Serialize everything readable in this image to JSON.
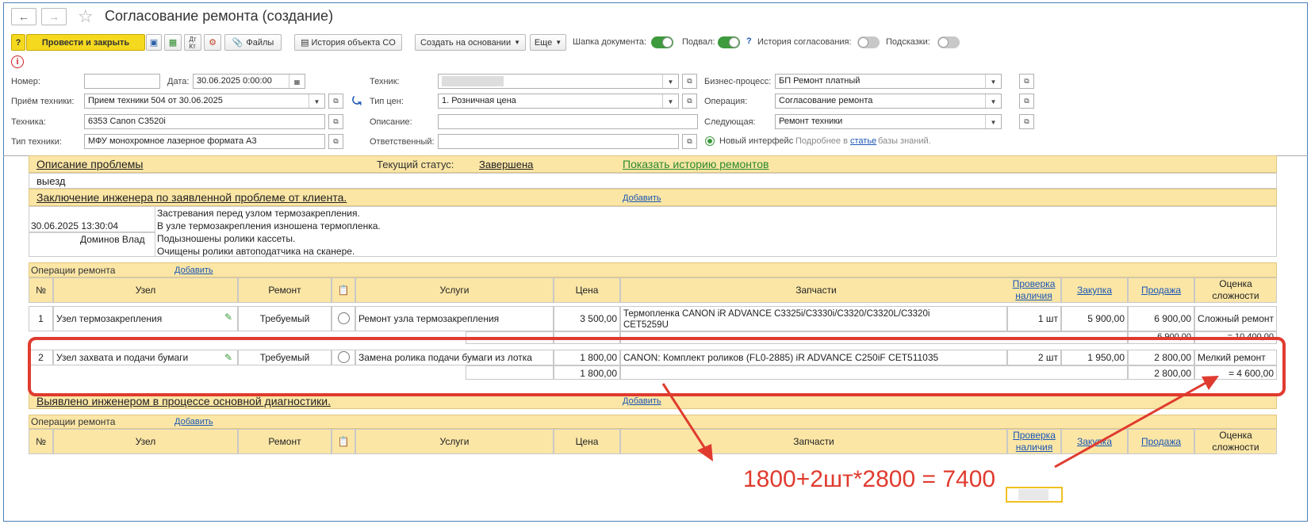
{
  "window": {
    "title": "Согласование ремонта (создание)"
  },
  "toolbar": {
    "post_close": "Провести и закрыть",
    "files": "Файлы",
    "history_co": "История объекта CO",
    "create_based": "Создать на основании",
    "more": "Еще",
    "doc_header": "Шапка документа:",
    "footer": "Подвал:",
    "help_q": "?",
    "approval_history": "История согласования:",
    "hints": "Подсказки:"
  },
  "form": {
    "number_label": "Номер:",
    "number_value": "",
    "date_label": "Дата:",
    "date_value": "30.06.2025  0:00:00",
    "technician_label": "Техник:",
    "technician_value": "",
    "business_process_label": "Бизнес-процесс:",
    "business_process_value": "БП Ремонт платный",
    "intake_label": "Приём техники:",
    "intake_value": "Прием техники 504 от 30.06.2025",
    "price_type_label": "Тип цен:",
    "price_type_value": "1. Розничная цена",
    "operation_label": "Операция:",
    "operation_value": "Согласование ремонта",
    "equipment_label": "Техника:",
    "equipment_value": "6353 Canon  C3520i",
    "description_label": "Описание:",
    "description_value": "",
    "next_label": "Следующая:",
    "next_value": "Ремонт техники",
    "equipment_type_label": "Тип техники:",
    "equipment_type_value": "МФУ монохромное лазерное формата А3",
    "responsible_label": "Ответственный:",
    "responsible_value": "",
    "new_interface": "Новый интерфейс",
    "more_in": "Подробнее в",
    "article": "статье",
    "kb": "базы знаний."
  },
  "problem": {
    "title": "Описание проблемы",
    "status_label": "Текущий статус:",
    "status_value": "Завершена",
    "history_link": "Показать историю ремонтов",
    "text": "выезд"
  },
  "conclusion": {
    "title": "Заключение инженера по заявленной проблеме от клиента.",
    "add": "Добавить",
    "datetime": "30.06.2025 13:30:04",
    "author": "Доминов Влад",
    "lines": [
      "Застревания перед узлом термозакрепления.",
      "В узле термозакрепления изношена термопленка.",
      "Подызношены ролики кассеты.",
      "Очищены ролики автоподатчика на сканере."
    ]
  },
  "ops_table": {
    "title": "Операции ремонта",
    "add": "Добавить",
    "headers": {
      "num": "№",
      "node": "Узел",
      "repair": "Ремонт",
      "services": "Услуги",
      "price": "Цена",
      "parts": "Запчасти",
      "check1": "Проверка",
      "check2": "наличия",
      "purchase": "Закупка",
      "sale": "Продажа",
      "complexity1": "Оценка",
      "complexity2": "сложности"
    },
    "rows": [
      {
        "num": "1",
        "node": "Узел термозакрепления",
        "repair": "Требуемый",
        "service": "Ремонт узла термозакрепления",
        "price": "3 500,00",
        "parts1": "Термопленка CANON iR ADVANCE C3325i/C3330i/C3320/C3320L/C3320i",
        "parts2": "CET5259U",
        "qty": "1 шт",
        "purchase": "5 900,00",
        "sale": "6 900,00",
        "complexity": "Сложный ремонт",
        "sub_price": "",
        "sub_sale": "6 900,00",
        "sub_total": "= 10 400,00"
      },
      {
        "num": "2",
        "node": "Узел захвата и подачи бумаги",
        "repair": "Требуемый",
        "service": "Замена ролика подачи бумаги из лотка",
        "price": "1 800,00",
        "parts1": "CANON: Комплект роликов (FL0-2885) iR ADVANCE C250iF CET511035",
        "parts2": "",
        "qty": "2 шт",
        "purchase": "1 950,00",
        "sale": "2 800,00",
        "complexity": "Мелкий ремонт",
        "sub_price": "1 800,00",
        "sub_sale": "2 800,00",
        "sub_total": "= 4 600,00"
      }
    ]
  },
  "detected": {
    "title": "Выявлено инженером в процессе основной диагностики.",
    "add": "Добавить"
  },
  "ops_table2": {
    "title": "Операции ремонта",
    "add": "Добавить"
  },
  "annotation": {
    "text": "1800+2шт*2800 = 7400",
    "color": "#e03b2f"
  }
}
